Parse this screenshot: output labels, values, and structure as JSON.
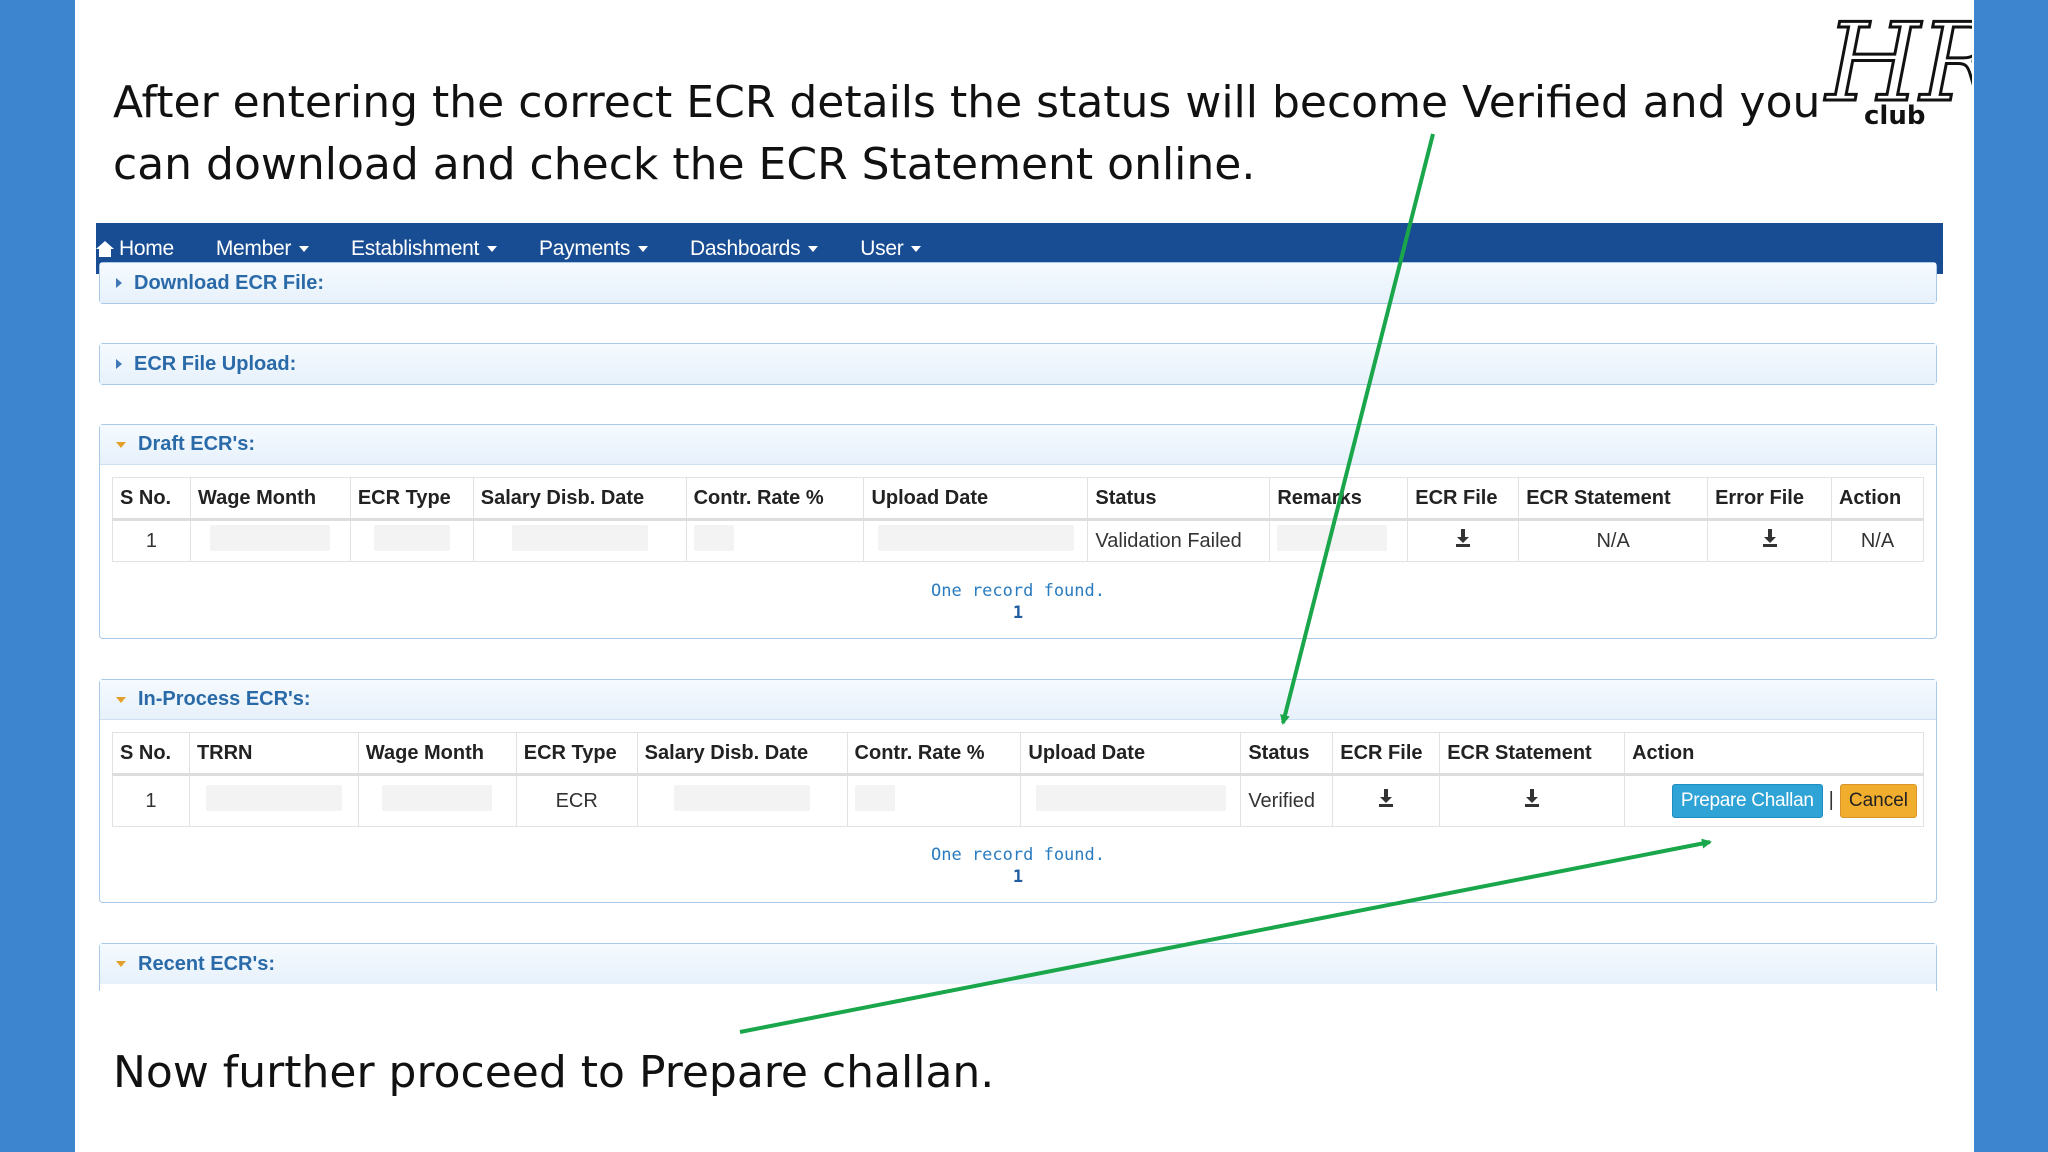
{
  "caption_top": "After entering the correct ECR details the status will become Verified and you can download and check the ECR Statement online.",
  "caption_bottom": "Now further proceed to Prepare challan.",
  "logo_text": "HR club",
  "colors": {
    "nav": "#184d93",
    "arrow": "#1aa64a",
    "background": "#3d85cf"
  },
  "nav": [
    "Home",
    "Member",
    "Establishment",
    "Payments",
    "Dashboards",
    "User"
  ],
  "sections": {
    "download": "Download ECR File:",
    "upload": "ECR File Upload:",
    "draft": "Draft ECR's:",
    "inprocess": "In-Process ECR's:",
    "recent": "Recent ECR's:"
  },
  "draft_table": {
    "headers": [
      "S No.",
      "Wage Month",
      "ECR Type",
      "Salary Disb. Date",
      "Contr. Rate %",
      "Upload Date",
      "Status",
      "Remarks",
      "ECR File",
      "ECR Statement",
      "Error File",
      "Action"
    ],
    "row": {
      "sno": "1",
      "status": "Validation Failed",
      "ecr_statement": "N/A",
      "action": "N/A",
      "ecr_file_icon": "download-icon",
      "error_file_icon": "download-icon"
    },
    "footer": "One record found.",
    "page": "1"
  },
  "inprocess_table": {
    "headers": [
      "S No.",
      "TRRN",
      "Wage Month",
      "ECR Type",
      "Salary Disb. Date",
      "Contr. Rate %",
      "Upload Date",
      "Status",
      "ECR File",
      "ECR Statement",
      "Action"
    ],
    "row": {
      "sno": "1",
      "ecr_type": "ECR",
      "status": "Verified",
      "prepare_label": "Prepare Challan",
      "separator": "|",
      "cancel_label": "Cancel",
      "ecr_file_icon": "download-icon",
      "ecr_statement_icon": "download-icon"
    },
    "footer": "One record found.",
    "page": "1"
  }
}
